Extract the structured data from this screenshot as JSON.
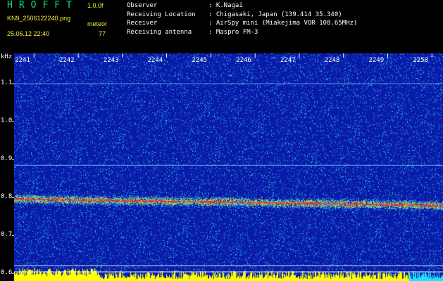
{
  "header": {
    "app_title": "HROFFT",
    "version": "1.0.0f",
    "filename": "KN9_2506122240.png",
    "meteor_label": "meteor",
    "datetime": "25.06.12 22:40",
    "meteor_count": "77"
  },
  "info": [
    {
      "key": "Observer",
      "sep": ":",
      "value": "K.Nagai"
    },
    {
      "key": "Receiving Location",
      "sep": ":",
      "value": "Chigasaki, Japan (139.414 35.340)"
    },
    {
      "key": "Receiver",
      "sep": ":",
      "value": "AirSpy mini (Miakejima VOR 108.65MHz)"
    },
    {
      "key": "Receiving antenna",
      "sep": ":",
      "value": "Maspro FM-3"
    }
  ],
  "colors": {
    "background": "#000000",
    "title": "#13e06a",
    "meta_text": "#f4ec3a",
    "plot_base": "#0a1aa0",
    "signal": "#e0302a",
    "reference_line": "#7fd4ff",
    "power_strip": "#ffff00"
  },
  "chart_data": {
    "type": "heatmap",
    "y_unit": "kHz",
    "y_ticks": [
      "1.1",
      "1.0",
      "0.9",
      "0.8",
      "0.7",
      "0.6"
    ],
    "x_ticks": [
      "2241",
      "2242",
      "2243",
      "2244",
      "2245",
      "2246",
      "2247",
      "2248",
      "2249",
      "2250"
    ],
    "ylim": [
      0.58,
      1.18
    ],
    "xlim": [
      2240.55,
      2250.25
    ],
    "reference_lines_khz": [
      1.1,
      0.885,
      0.62,
      0.604
    ],
    "carrier_track": {
      "x": [
        2240.55,
        2241.5,
        2242.5,
        2243.5,
        2244.5,
        2245.5,
        2246.5,
        2247.5,
        2248.5,
        2249.5,
        2250.25
      ],
      "khz": [
        0.797,
        0.795,
        0.793,
        0.791,
        0.79,
        0.789,
        0.786,
        0.785,
        0.783,
        0.781,
        0.779
      ]
    }
  }
}
